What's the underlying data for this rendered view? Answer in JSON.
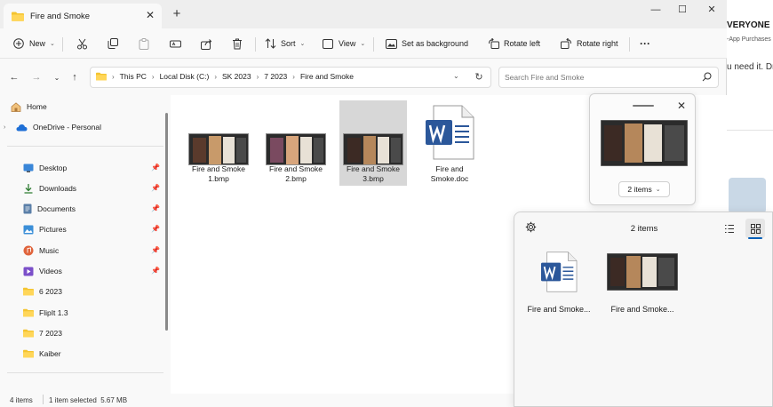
{
  "window": {
    "tab_title": "Fire and Smoke",
    "new_tab": "+",
    "minimize": "—",
    "maximize": "☐",
    "close": "✕",
    "tab_close": "✕"
  },
  "toolbar": {
    "new": "New",
    "sort": "Sort",
    "view": "View",
    "set_background": "Set as background",
    "rotate_left": "Rotate left",
    "rotate_right": "Rotate right",
    "more": "···"
  },
  "address": {
    "crumbs": [
      "This PC",
      "Local Disk (C:)",
      "SK 2023",
      "7 2023",
      "Fire and Smoke"
    ],
    "search_placeholder": "Search Fire and Smoke"
  },
  "sidebar": {
    "home": "Home",
    "onedrive": "OneDrive - Personal",
    "quick": [
      "Desktop",
      "Downloads",
      "Documents",
      "Pictures",
      "Music",
      "Videos"
    ],
    "folders": [
      "6 2023",
      "FlipIt 1.3",
      "7 2023",
      "Kaiber"
    ]
  },
  "files": [
    {
      "name": "Fire and Smoke 1.bmp",
      "line1": "Fire and Smoke",
      "line2": "1.bmp",
      "selected": false,
      "type": "image"
    },
    {
      "name": "Fire and Smoke 2.bmp",
      "line1": "Fire and Smoke",
      "line2": "2.bmp",
      "selected": false,
      "type": "image"
    },
    {
      "name": "Fire and Smoke 3.bmp",
      "line1": "Fire and Smoke",
      "line2": "3.bmp",
      "selected": true,
      "type": "image"
    },
    {
      "name": "Fire and Smoke.doc",
      "line1": "Fire and",
      "line2": "Smoke.doc",
      "selected": false,
      "type": "word"
    }
  ],
  "status": {
    "items": "4 items",
    "selected": "1 item selected  5.67 MB"
  },
  "drag_popup": {
    "count": "2 items",
    "close": "✕"
  },
  "tray": {
    "count": "2 items",
    "items": [
      "Fire and Smoke...",
      "Fire and Smoke..."
    ]
  },
  "background_window": {
    "title": "VERYONE",
    "subtitle": "-App Purchases",
    "text": "u need it. Dr"
  },
  "colors": {
    "accent": "#005fb8",
    "folder": "#f4c430",
    "word": "#2b579a"
  }
}
